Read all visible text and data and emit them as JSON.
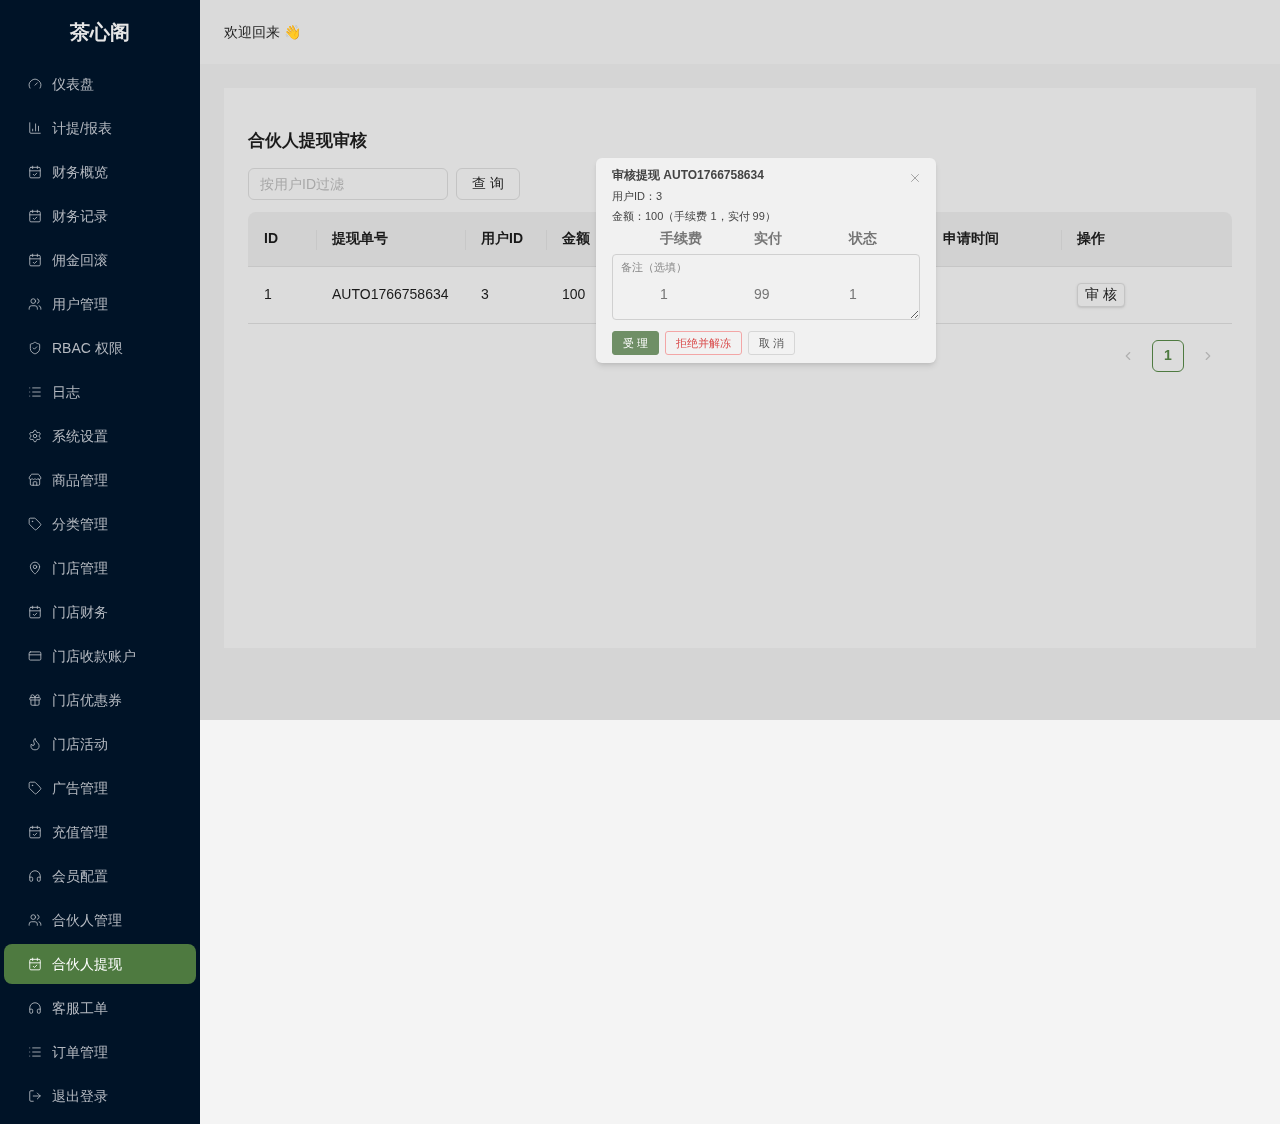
{
  "sidebar": {
    "title": "茶心阁",
    "items": [
      {
        "label": "仪表盘",
        "selected": false
      },
      {
        "label": "计提/报表",
        "selected": false
      },
      {
        "label": "财务概览",
        "selected": false
      },
      {
        "label": "财务记录",
        "selected": false
      },
      {
        "label": "佣金回滚",
        "selected": false
      },
      {
        "label": "用户管理",
        "selected": false
      },
      {
        "label": "RBAC 权限",
        "selected": false
      },
      {
        "label": "日志",
        "selected": false
      },
      {
        "label": "系统设置",
        "selected": false
      },
      {
        "label": "商品管理",
        "selected": false
      },
      {
        "label": "分类管理",
        "selected": false
      },
      {
        "label": "门店管理",
        "selected": false
      },
      {
        "label": "门店财务",
        "selected": false
      },
      {
        "label": "门店收款账户",
        "selected": false
      },
      {
        "label": "门店优惠券",
        "selected": false
      },
      {
        "label": "门店活动",
        "selected": false
      },
      {
        "label": "广告管理",
        "selected": false
      },
      {
        "label": "充值管理",
        "selected": false
      },
      {
        "label": "会员配置",
        "selected": false
      },
      {
        "label": "合伙人管理",
        "selected": false
      },
      {
        "label": "合伙人提现",
        "selected": true
      },
      {
        "label": "客服工单",
        "selected": false
      },
      {
        "label": "订单管理",
        "selected": false
      },
      {
        "label": "退出登录",
        "selected": false
      }
    ]
  },
  "header": {
    "greeting": "欢迎回来 👋"
  },
  "page": {
    "title": "合伙人提现审核",
    "filter": {
      "placeholder": "按用户ID过滤"
    },
    "query_button": "查 询",
    "table": {
      "columns": [
        "ID",
        "提现单号",
        "用户ID",
        "金额",
        "手续费",
        "实付",
        "状态",
        "申请时间",
        "操作"
      ],
      "rows": [
        {
          "cells": [
            "1",
            "AUTO1766758634",
            "3",
            "100",
            "1",
            "99",
            "1"
          ],
          "action": "审 核"
        }
      ]
    },
    "pagination": {
      "pages": [
        {
          "label": "1",
          "selected": true
        }
      ]
    }
  },
  "modal": {
    "title": "审核提现 AUTO1766758634",
    "user_line": "用户ID：3",
    "amount_line": "金额：100（手续费 1，实付 99）",
    "remark": {
      "placeholder": "备注（选填）"
    },
    "buttons": [
      {
        "label": "受 理",
        "kind": "primary"
      },
      {
        "label": "拒绝并解冻",
        "kind": "danger"
      },
      {
        "label": "取 消",
        "kind": "default"
      }
    ]
  }
}
